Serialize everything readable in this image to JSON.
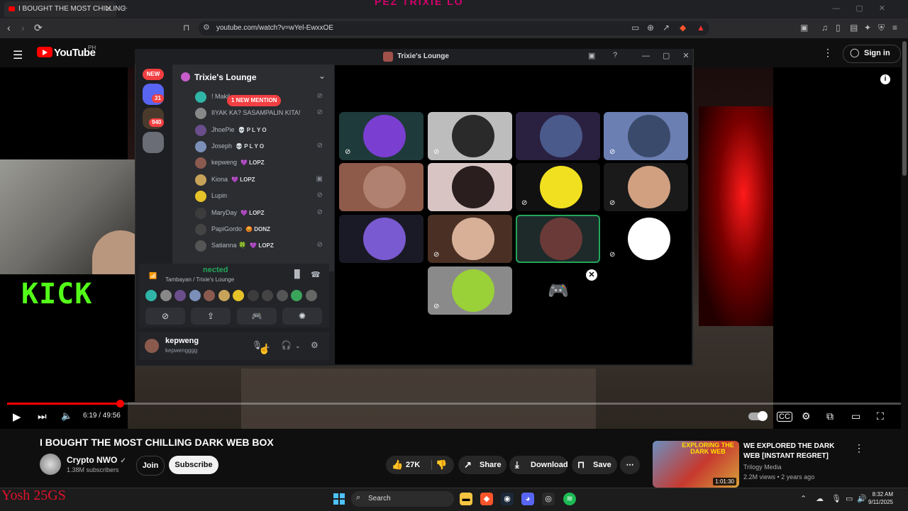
{
  "browser": {
    "tab_title": "I BOUGHT THE MOST CHILLING",
    "url": "youtube.com/watch?v=wYel-EwxxOE",
    "new_tab": "+",
    "overlay_top_text": "PEZ  TRIXIE LO"
  },
  "youtube": {
    "logo_text": "YouTube",
    "region": "PH",
    "sign_in": "Sign in",
    "player": {
      "current_time": "6:19",
      "duration": "49:56",
      "time_readout": "6:19 / 49:56",
      "progress_fraction": 0.1265
    },
    "video_title": "I BOUGHT THE MOST CHILLING DARK WEB BOX",
    "channel": {
      "name": "Crypto NWO",
      "verified": "✓",
      "subscribers": "1.38M subscribers"
    },
    "join_label": "Join",
    "subscribe_label": "Subscribe",
    "likes": "27K",
    "share_label": "Share",
    "download_label": "Download",
    "save_label": "Save",
    "recommended": {
      "title": "WE EXPLORED THE DARK WEB [INSTANT REGRET]",
      "channel": "Trilogy Media",
      "meta": "2.2M views • 2 years ago",
      "duration": "1:01:30",
      "thumb_text": "EXPLORING THE DARK WEB"
    }
  },
  "stream_overlay": {
    "kick_text": "KICK",
    "bottom_text": "Yosh 25GS"
  },
  "discord": {
    "window_title": "Trixie's Lounge",
    "server_name": "Trixie's Lounge",
    "new_badge": "NEW",
    "server_badges": [
      "31",
      "940"
    ],
    "new_mention": "1 NEW MENTION",
    "members": [
      {
        "name": "! Makil",
        "tag": "",
        "color": "#2fb6a8"
      },
      {
        "name": "IIYAK KA? SASAMPALIN KITA!",
        "tag": "",
        "color": "#888888"
      },
      {
        "name": "JhoePie",
        "tag": "💀 P L Y O",
        "color": "#6a4e8c"
      },
      {
        "name": "Joseph",
        "tag": "💀 P L Y O",
        "color": "#7b8fb8"
      },
      {
        "name": "kepweng",
        "tag": "💜 LOPZ",
        "color": "#8b5a4e"
      },
      {
        "name": "Kiona",
        "tag": "💜 LOPZ",
        "color": "#c7a35a"
      },
      {
        "name": "Lupin",
        "tag": "",
        "color": "#e6c229"
      },
      {
        "name": "MaryDay",
        "tag": "💜 LOPZ",
        "color": "#3c3c3c"
      },
      {
        "name": "PapiGordo",
        "tag": "😡 DONZ",
        "color": "#444444"
      },
      {
        "name": "Satianna 🍀",
        "tag": "💜 LOPZ",
        "color": "#555555"
      }
    ],
    "voice_status": "Voice Connected",
    "voice_status_visible": "nected",
    "voice_location": "Tambayan / Trixie's Lounge",
    "user": {
      "name": "kepweng",
      "handle": "kepwengggg"
    }
  },
  "taskbar": {
    "search_label": "Search",
    "time": "8:32 AM",
    "date": "9/11/2025"
  },
  "colors": {
    "youtube_red": "#ff0000",
    "kick_green": "#53fc18",
    "discord_bg": "#1e1f22",
    "discord_channels": "#2b2d31",
    "voice_green": "#23a55a",
    "mention_red": "#f23f42"
  }
}
